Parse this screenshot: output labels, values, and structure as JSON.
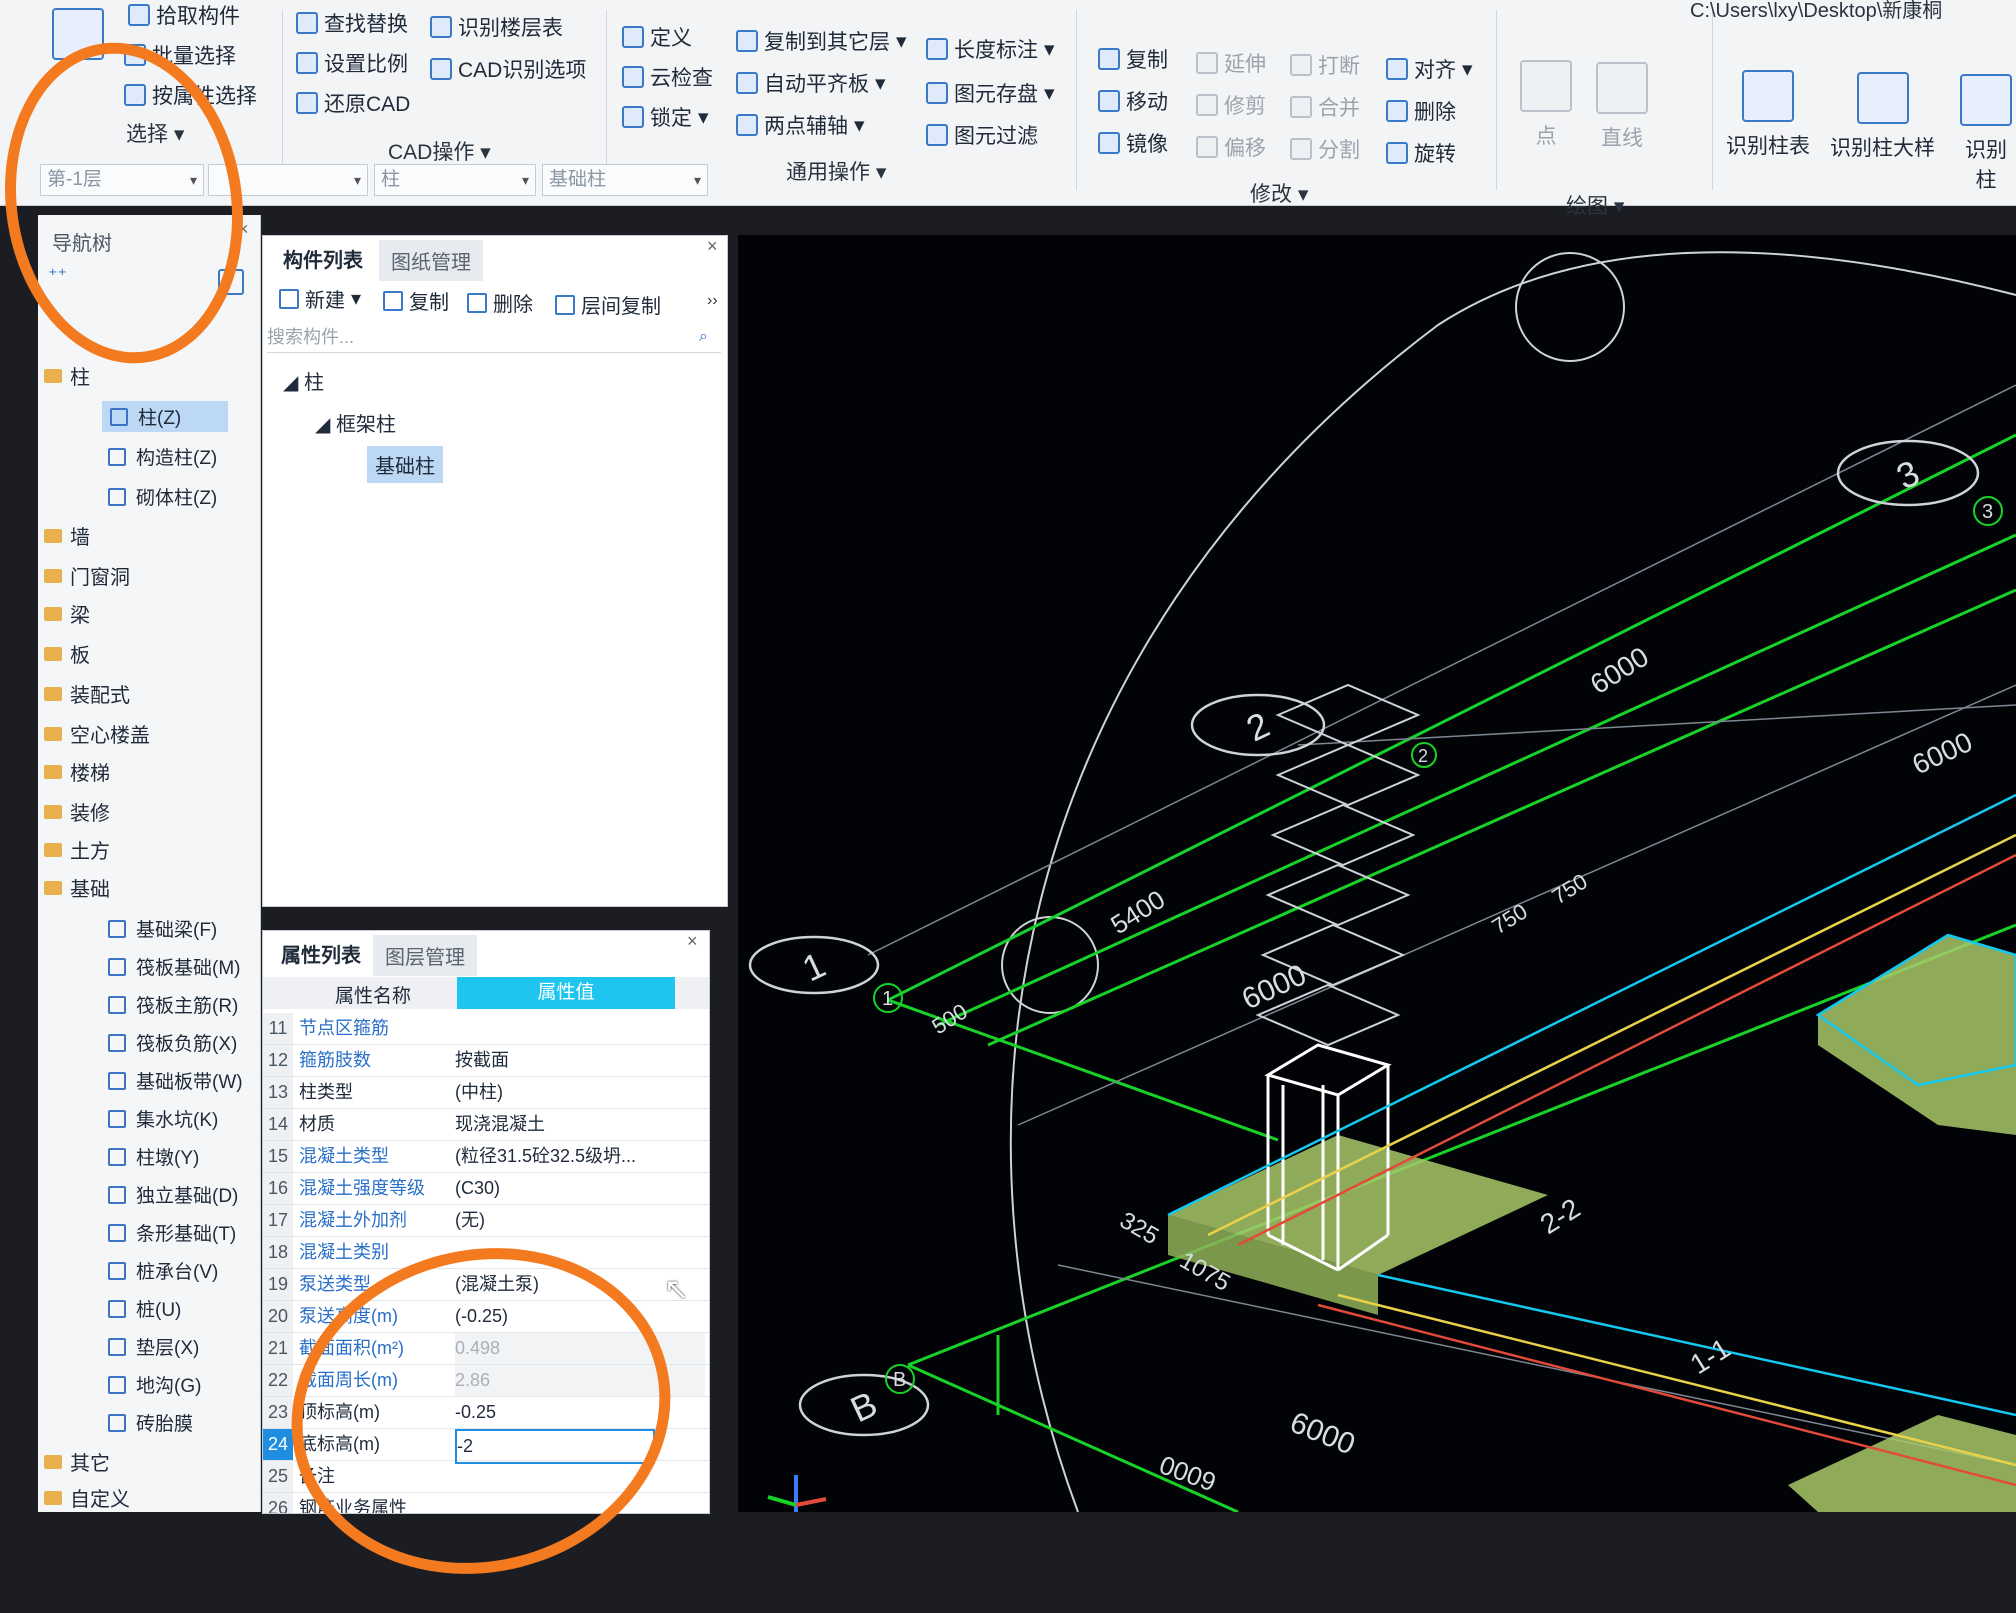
{
  "ribbon": {
    "pick_component": "拾取构件",
    "batch_select": "批量选择",
    "select_by_property": "按属性选择",
    "select_group": "选择",
    "find_replace": "查找替换",
    "set_scale": "设置比例",
    "restore_cad": "还原CAD",
    "identify_floor_table": "识别楼层表",
    "cad_identify_options": "CAD识别选项",
    "cad_ops_group": "CAD操作",
    "define": "定义",
    "cloud_check": "云检查",
    "lock": "锁定",
    "copy_to_other_floor": "复制到其它层",
    "auto_flat_slab": "自动平齐板",
    "two_point_axis": "两点辅轴",
    "length_dim": "长度标注",
    "save_element": "图元存盘",
    "element_filter": "图元过滤",
    "general_ops_group": "通用操作",
    "copy": "复制",
    "move": "移动",
    "mirror": "镜像",
    "extend": "延伸",
    "trim": "修剪",
    "offset": "偏移",
    "break": "打断",
    "merge": "合并",
    "split": "分割",
    "align": "对齐",
    "delete": "删除",
    "rotate": "旋转",
    "modify_group": "修改",
    "point": "点",
    "line": "直线",
    "draw_group": "绘图",
    "identify_column_table": "识别柱表",
    "identify_column_detail": "识别柱大样",
    "identify_column": "识别柱",
    "path_fragment": "C:\\Users\\lxy\\Desktop\\新康桐"
  },
  "combos": {
    "floor": "第-1层",
    "type": "柱",
    "component": "基础柱"
  },
  "nav": {
    "title": "导航树",
    "categories": [
      {
        "label": "柱"
      },
      {
        "label": "墙"
      },
      {
        "label": "门窗洞"
      },
      {
        "label": "梁"
      },
      {
        "label": "板"
      },
      {
        "label": "装配式"
      },
      {
        "label": "空心楼盖"
      },
      {
        "label": "楼梯"
      },
      {
        "label": "装修"
      },
      {
        "label": "土方"
      },
      {
        "label": "基础"
      },
      {
        "label": "其它"
      },
      {
        "label": "自定义"
      }
    ],
    "column_items": [
      {
        "label": "柱(Z)"
      },
      {
        "label": "构造柱(Z)"
      },
      {
        "label": "砌体柱(Z)"
      }
    ],
    "foundation_items": [
      {
        "label": "基础梁(F)"
      },
      {
        "label": "筏板基础(M)"
      },
      {
        "label": "筏板主筋(R)"
      },
      {
        "label": "筏板负筋(X)"
      },
      {
        "label": "基础板带(W)"
      },
      {
        "label": "集水坑(K)"
      },
      {
        "label": "柱墩(Y)"
      },
      {
        "label": "独立基础(D)"
      },
      {
        "label": "条形基础(T)"
      },
      {
        "label": "桩承台(V)"
      },
      {
        "label": "桩(U)"
      },
      {
        "label": "垫层(X)"
      },
      {
        "label": "地沟(G)"
      },
      {
        "label": "砖胎膜"
      }
    ]
  },
  "component_list": {
    "tab_components": "构件列表",
    "tab_drawings": "图纸管理",
    "new": "新建",
    "copy": "复制",
    "delete": "删除",
    "floor_copy": "层间复制",
    "search_placeholder": "搜索构件...",
    "tree_root": "柱",
    "tree_group": "框架柱",
    "tree_item": "基础柱"
  },
  "properties": {
    "tab_props": "属性列表",
    "tab_layers": "图层管理",
    "col_name": "属性名称",
    "col_value": "属性值",
    "rows": [
      {
        "num": "11",
        "name": "节点区箍筋",
        "value": ""
      },
      {
        "num": "12",
        "name": "箍筋肢数",
        "value": "按截面"
      },
      {
        "num": "13",
        "name": "柱类型",
        "value": "(中柱)"
      },
      {
        "num": "14",
        "name": "材质",
        "value": "现浇混凝土"
      },
      {
        "num": "15",
        "name": "混凝土类型",
        "value": "(粒径31.5砼32.5级坍..."
      },
      {
        "num": "16",
        "name": "混凝土强度等级",
        "value": "(C30)"
      },
      {
        "num": "17",
        "name": "混凝土外加剂",
        "value": "(无)"
      },
      {
        "num": "18",
        "name": "混凝土类别",
        "value": ""
      },
      {
        "num": "19",
        "name": "泵送类型",
        "value": "(混凝土泵)"
      },
      {
        "num": "20",
        "name": "泵送高度(m)",
        "value": "(-0.25)"
      },
      {
        "num": "21",
        "name": "截面面积(m²)",
        "value": "0.498"
      },
      {
        "num": "22",
        "name": "截面周长(m)",
        "value": "2.86"
      },
      {
        "num": "23",
        "name": "顶标高(m)",
        "value": "-0.25"
      },
      {
        "num": "24",
        "name": "底标高(m)",
        "value": "-2"
      },
      {
        "num": "25",
        "name": "备注",
        "value": ""
      },
      {
        "num": "26",
        "name": "钢筋业务属性",
        "value": ""
      }
    ]
  },
  "drawing": {
    "axis_1": "1",
    "axis_2": "2",
    "axis_3": "3",
    "axis_b": "B",
    "dim_6000_a": "6000",
    "dim_6000_b": "6000",
    "dim_6000_c": "6000",
    "dim_6000_d": "6000",
    "dim_6000_e": "6000",
    "dim_5400": "5400",
    "dim_500": "500",
    "dim_750_a": "750",
    "dim_750_b": "750",
    "dim_325": "325",
    "dim_1075": "1075",
    "section_2": "2-2",
    "section_1": "1-1"
  },
  "colors": {
    "annotation": "#f47a1f",
    "axis_green": "#19d228",
    "cyan": "#15c8f0",
    "footing": "#a8c96a"
  }
}
